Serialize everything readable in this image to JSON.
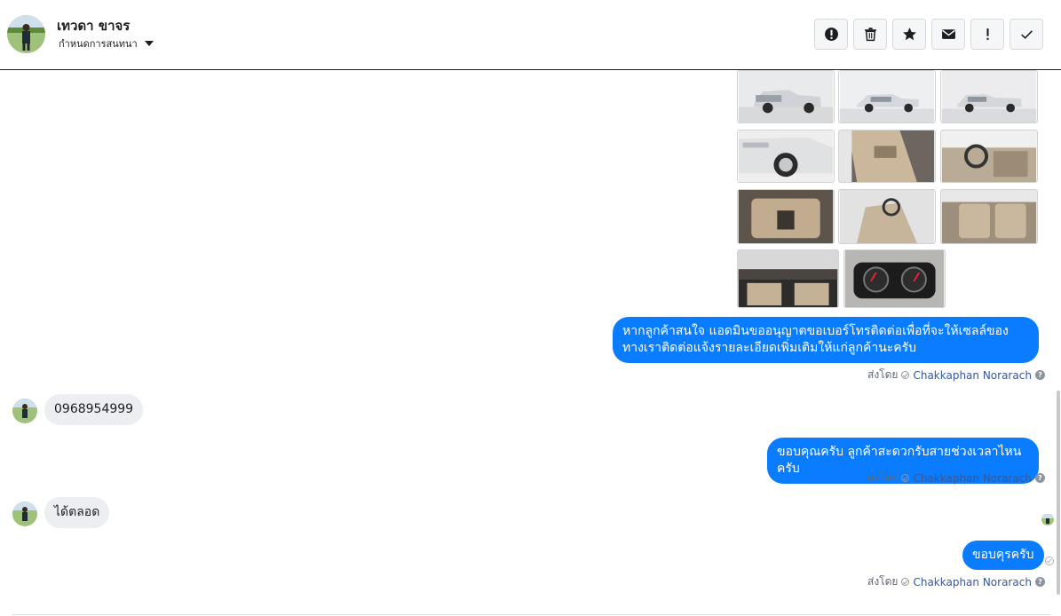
{
  "header": {
    "contact_name": "เทวดา ขาจร",
    "assign_label": "กำหนดการสนทนา"
  },
  "actions": [
    {
      "name": "alert-icon",
      "label": "spam"
    },
    {
      "name": "trash-icon",
      "label": "delete"
    },
    {
      "name": "star-icon",
      "label": "star"
    },
    {
      "name": "envelope-icon",
      "label": "mark unread"
    },
    {
      "name": "exclamation-icon",
      "label": "follow up"
    },
    {
      "name": "checkmark-icon",
      "label": "done"
    }
  ],
  "messages": {
    "out1": "หากลูกค้าสนใจ แอดมินขออนุญาตขอเบอร์โทรติดต่อเพื่อที่จะให้เซลล์ของทางเราติดต่อแจ้งรายละเอียดเพิ่มเติมให้แก่ลูกค้านะครับ",
    "in1": "0968954999",
    "out2": "ขอบคุณครับ ลูกค้าสะดวกรับสายช่วงเวลาไหนครับ",
    "in2": "ได้ตลอด",
    "out3": "ขอบคุรครับ"
  },
  "sent_by": {
    "prefix": "ส่งโดย",
    "agent": "Chakkaphan Norarach",
    "help": "?"
  },
  "colors": {
    "outgoing_bubble": "#0a7cff",
    "incoming_bubble": "#eceef1",
    "agent_link": "#385898"
  }
}
